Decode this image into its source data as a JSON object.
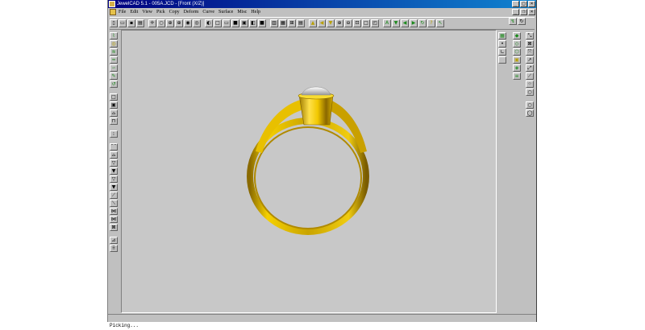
{
  "window": {
    "title": "JewelCAD 5.1 - 005A.JCD - [Front (X/Z)]",
    "min": "_",
    "max": "□",
    "close": "×",
    "doc_min": "_",
    "doc_restore": "❐",
    "doc_close": "×"
  },
  "menu": [
    "File",
    "Edit",
    "View",
    "Pick",
    "Copy",
    "Deform",
    "Curve",
    "Surface",
    "Misc",
    "Help"
  ],
  "toolbar": [
    {
      "name": "new-icon",
      "glyph": "▯"
    },
    {
      "name": "open-icon",
      "glyph": "▭"
    },
    {
      "name": "save-icon",
      "glyph": "▪"
    },
    {
      "name": "print-icon",
      "glyph": "▤"
    },
    {
      "name": "sep"
    },
    {
      "name": "select-cursor-icon",
      "glyph": "✛"
    },
    {
      "name": "circle-icon",
      "glyph": "○"
    },
    {
      "name": "target-icon",
      "glyph": "⊕"
    },
    {
      "name": "crosshair-icon",
      "glyph": "⊕"
    },
    {
      "name": "wheel-icon",
      "glyph": "◉"
    },
    {
      "name": "dot-circle-icon",
      "glyph": "◎"
    },
    {
      "name": "sep"
    },
    {
      "name": "view-left-icon",
      "glyph": "◐"
    },
    {
      "name": "view-box-icon",
      "glyph": "□"
    },
    {
      "name": "view-bottom-icon",
      "glyph": "▭"
    },
    {
      "name": "view-solid-icon",
      "glyph": "■"
    },
    {
      "name": "view-frame-icon",
      "glyph": "▣"
    },
    {
      "name": "view-split-icon",
      "glyph": "◧"
    },
    {
      "name": "view-fill-icon",
      "glyph": "■"
    },
    {
      "name": "sep"
    },
    {
      "name": "grid-2-icon",
      "glyph": "▥"
    },
    {
      "name": "grid-3-icon",
      "glyph": "▦"
    },
    {
      "name": "grid-4-icon",
      "glyph": "⊞"
    },
    {
      "name": "grid-h-icon",
      "glyph": "▤"
    },
    {
      "name": "sep"
    },
    {
      "name": "triangle-up-icon",
      "glyph": "▲",
      "tone": "y"
    },
    {
      "name": "arrow-left-icon",
      "glyph": "◀",
      "tone": "y"
    },
    {
      "name": "triangle-down-icon",
      "glyph": "▼",
      "tone": "y"
    },
    {
      "name": "zoom-in-icon",
      "glyph": "⊕"
    },
    {
      "name": "zoom-out-icon",
      "glyph": "⊖"
    },
    {
      "name": "zoom-window-icon",
      "glyph": "⊡"
    },
    {
      "name": "zoom-all-icon",
      "glyph": "□"
    },
    {
      "name": "zoom-prev-icon",
      "glyph": "◰"
    },
    {
      "name": "sep"
    },
    {
      "name": "text-a-icon",
      "glyph": "A",
      "tone": "g"
    },
    {
      "name": "arrow-down-green-icon",
      "glyph": "▼",
      "tone": "g"
    },
    {
      "name": "arrow-left-green-icon",
      "glyph": "◀",
      "tone": "g"
    },
    {
      "name": "arrow-right-green-icon",
      "glyph": "▶",
      "tone": "g"
    },
    {
      "name": "rotate-icon",
      "glyph": "↻",
      "tone": "g"
    },
    {
      "name": "help-icon",
      "glyph": "?",
      "tone": "y"
    },
    {
      "name": "pointer-help-icon",
      "glyph": "↖",
      "tone": "g"
    }
  ],
  "right_toolbar": [
    {
      "name": "render-icon",
      "glyph": "↯",
      "tone": "g"
    },
    {
      "name": "rotate-view-icon",
      "glyph": "↻"
    }
  ],
  "left_tools": [
    {
      "name": "curve-tool-icon",
      "glyph": "⌇",
      "tone": "g"
    },
    {
      "name": "lasso-tool-icon",
      "glyph": "◎",
      "tone": "y"
    },
    {
      "name": "sweep-tool-icon",
      "glyph": "≋",
      "tone": "g"
    },
    {
      "name": "loft-tool-icon",
      "glyph": "≈",
      "tone": "g"
    },
    {
      "name": "pipe-tool-icon",
      "glyph": "∽",
      "tone": "g"
    },
    {
      "name": "pencil-tool-icon",
      "glyph": "✎",
      "tone": "g"
    },
    {
      "name": "revolve-tool-icon",
      "glyph": "↺",
      "tone": "g"
    },
    {
      "name": "gap"
    },
    {
      "name": "rect-tool-icon",
      "glyph": "□"
    },
    {
      "name": "frame-tool-icon",
      "glyph": "▣"
    },
    {
      "name": "ellipse-tool-icon",
      "glyph": "⌓"
    },
    {
      "name": "door-tool-icon",
      "glyph": "⊓"
    },
    {
      "name": "gap"
    },
    {
      "name": "grid-snap-icon",
      "glyph": "⁝"
    },
    {
      "name": "gap"
    },
    {
      "name": "arc-tool-icon",
      "glyph": "⌒"
    },
    {
      "name": "bend-tool-icon",
      "glyph": "⌓"
    },
    {
      "name": "taper-tool-icon",
      "glyph": "▽"
    },
    {
      "name": "funnel-tool-icon",
      "glyph": "▼"
    },
    {
      "name": "wedge-tool-icon",
      "glyph": "▽"
    },
    {
      "name": "cone-tool-icon",
      "glyph": "▼"
    },
    {
      "name": "slant-tool-icon",
      "glyph": "⟋"
    },
    {
      "name": "shear-tool-icon",
      "glyph": "⟍"
    },
    {
      "name": "bow-tool-icon",
      "glyph": "⋈"
    },
    {
      "name": "twist-tool-icon",
      "glyph": "⋈"
    },
    {
      "name": "mesh-tool-icon",
      "glyph": "⊠"
    },
    {
      "name": "gap"
    },
    {
      "name": "ruler-tool-icon",
      "glyph": "⊿"
    },
    {
      "name": "dots-tool-icon",
      "glyph": "⠿"
    }
  ],
  "right_tools_a": [
    {
      "name": "layer-copy-icon",
      "glyph": "▦",
      "tone": "g"
    },
    {
      "name": "point-icon",
      "glyph": "•"
    },
    {
      "name": "corner-icon",
      "glyph": "∟"
    },
    {
      "name": "blank-icon",
      "glyph": ""
    }
  ],
  "right_tools_b": [
    {
      "name": "gem-round-icon",
      "glyph": "◆",
      "tone": "g"
    },
    {
      "name": "gem-oval-icon",
      "glyph": "◇",
      "tone": "g"
    },
    {
      "name": "gem-shape-icon",
      "glyph": "⬡",
      "tone": "g"
    },
    {
      "name": "gem-square-icon",
      "glyph": "▣",
      "tone": "y"
    },
    {
      "name": "gem-cut-icon",
      "glyph": "◈",
      "tone": "g"
    },
    {
      "name": "gem-ribbon-icon",
      "glyph": "≡",
      "tone": "g"
    }
  ],
  "right_tools_c": [
    {
      "name": "scale-tool-icon",
      "glyph": "⤡"
    },
    {
      "name": "scale-xy-icon",
      "glyph": "⊠"
    },
    {
      "name": "rotate-tool-icon",
      "glyph": "⤧"
    },
    {
      "name": "move-tool-icon",
      "glyph": "↗"
    },
    {
      "name": "stretch-tool-icon",
      "glyph": "⤢"
    },
    {
      "name": "mirror-tool-icon",
      "glyph": "⟋"
    },
    {
      "name": "array-tool-icon",
      "glyph": "⁘"
    },
    {
      "name": "circle-tool-icon",
      "glyph": "○"
    },
    {
      "name": "gap"
    },
    {
      "name": "ring-tool-icon",
      "glyph": "○"
    },
    {
      "name": "oval-tool-icon",
      "glyph": "◯"
    }
  ],
  "status": "Picking..."
}
